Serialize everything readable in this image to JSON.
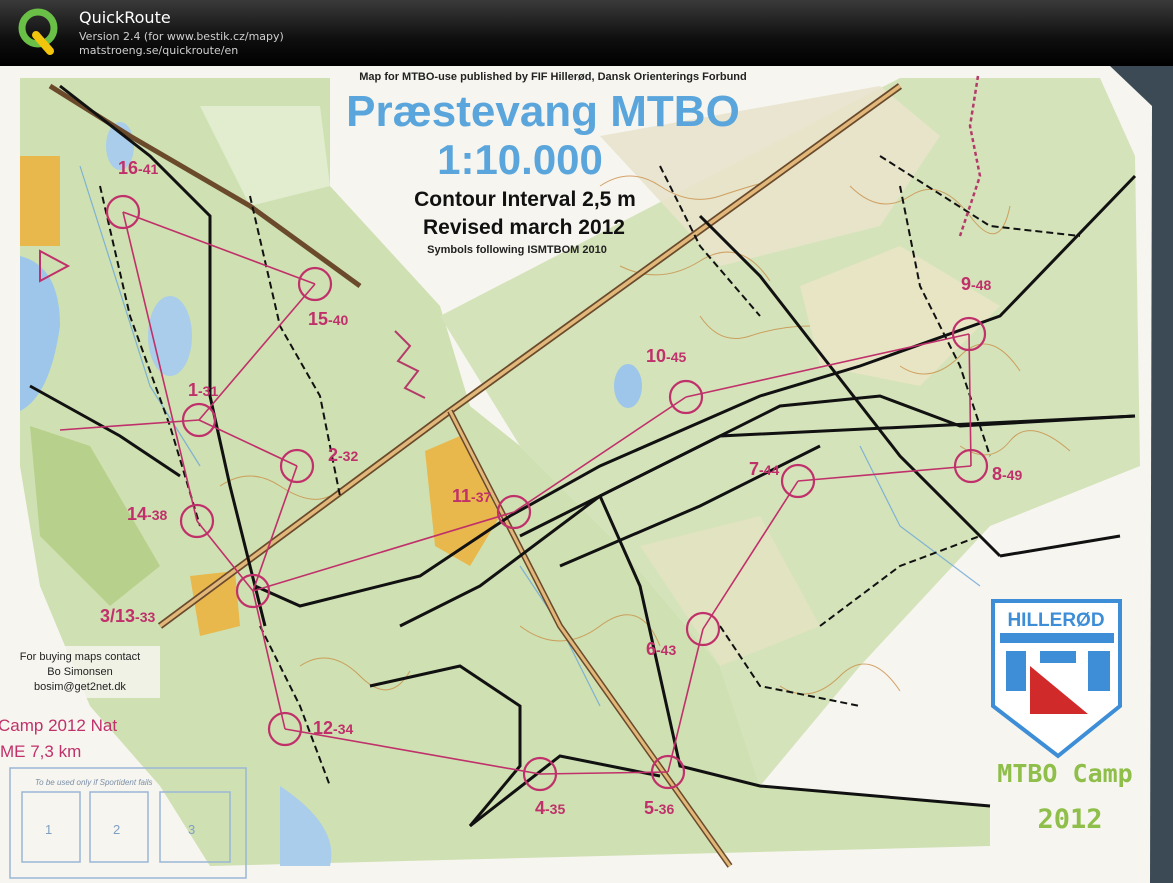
{
  "app": {
    "name": "QuickRoute",
    "version": "Version 2.4  (for www.bestik.cz/mapy)",
    "url": "matstroeng.se/quickroute/en",
    "logo_icon": "quickroute-q-logo"
  },
  "map": {
    "publisher": "Map for MTBO-use published by FIF Hillerød, Dansk Orienterings Forbund",
    "title": "Præstevang MTBO",
    "scale": "1:10.000",
    "contour": "Contour Interval 2,5 m",
    "revised": "Revised march 2012",
    "symbols": "Symbols following ISMTBOM 2010",
    "contact": {
      "line1": "For buying maps contact",
      "line2": "Bo Simonsen",
      "line3": "bosim@get2net.dk"
    },
    "course": {
      "line1": "Camp 2012 Nat",
      "line2": "ME 7,3 km"
    },
    "box_note": "To be used only if Sportident fails",
    "boxes": [
      "1",
      "2",
      "3"
    ],
    "club": "HILLERØD",
    "camp": {
      "line1": "MTBO Camp",
      "line2": "2012"
    },
    "controls": [
      {
        "label": "16",
        "code": "41"
      },
      {
        "label": "15",
        "code": "40"
      },
      {
        "label": "1",
        "code": "31"
      },
      {
        "label": "2",
        "code": "32"
      },
      {
        "label": "14",
        "code": "38"
      },
      {
        "label": "3/13",
        "code": "33"
      },
      {
        "label": "11",
        "code": "37"
      },
      {
        "label": "10",
        "code": "45"
      },
      {
        "label": "9",
        "code": "48"
      },
      {
        "label": "8",
        "code": "49"
      },
      {
        "label": "7",
        "code": "44"
      },
      {
        "label": "6",
        "code": "43"
      },
      {
        "label": "12",
        "code": "34"
      },
      {
        "label": "4",
        "code": "35"
      },
      {
        "label": "5",
        "code": "36"
      }
    ]
  },
  "colors": {
    "course_magenta": "#c0306a",
    "title_blue": "#5aa6dc",
    "forest_green": "#c5d8a8",
    "paper": "#f4f2ea",
    "camp_green": "#8fbf4a"
  }
}
